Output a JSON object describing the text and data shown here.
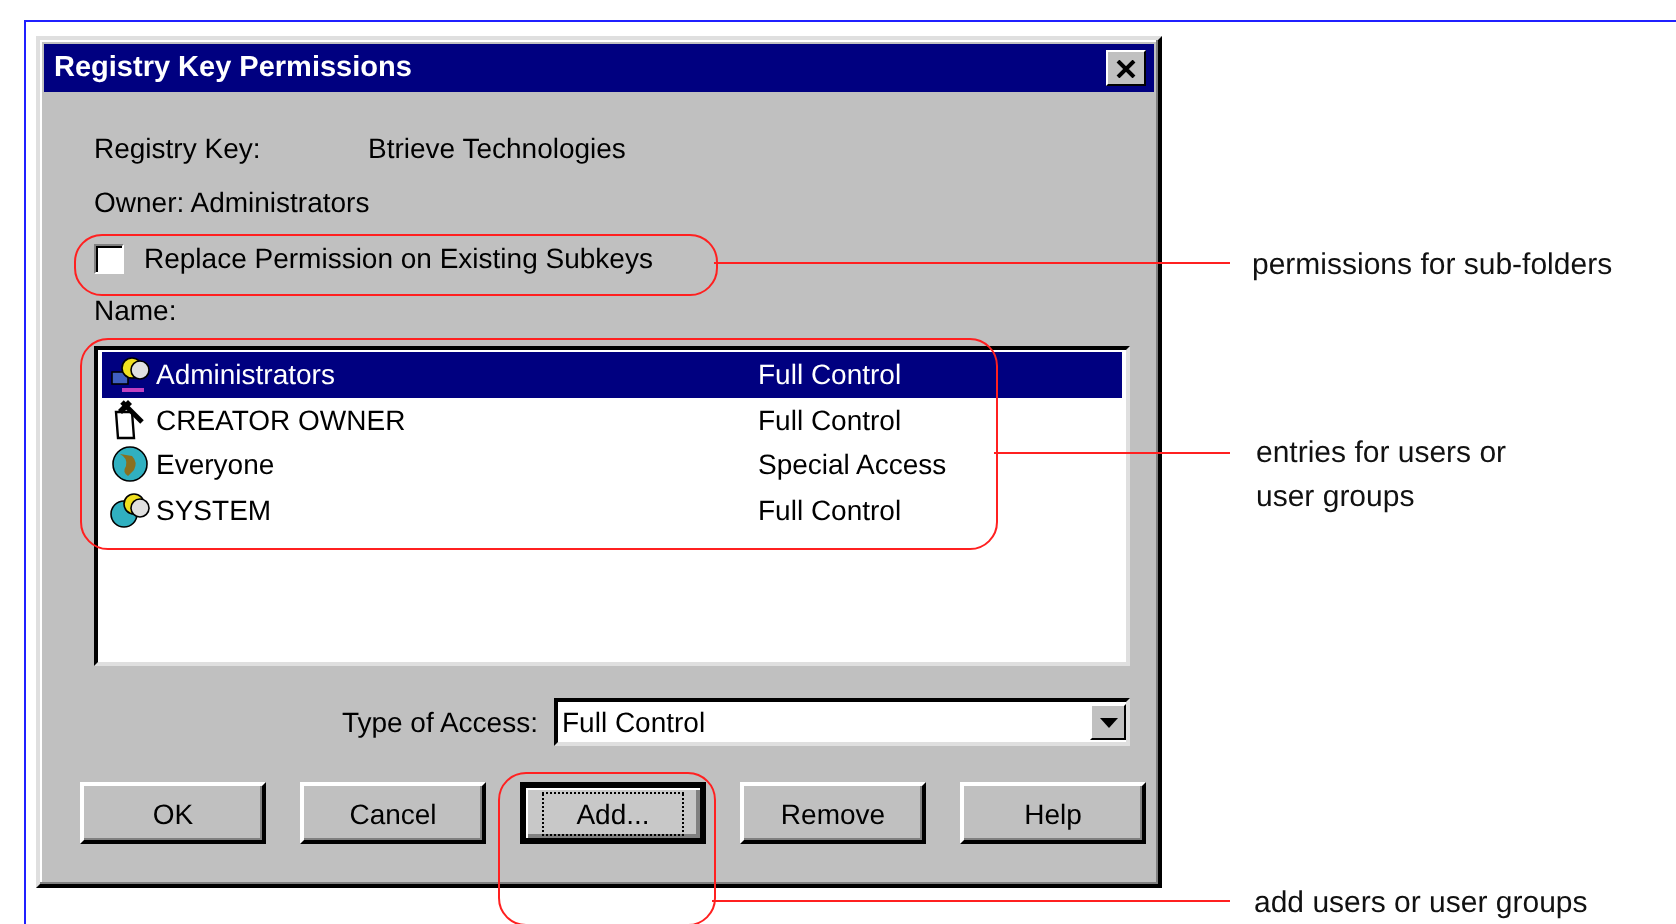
{
  "window": {
    "title": "Registry Key Permissions"
  },
  "registry_key": {
    "label": "Registry Key:",
    "value": "Btrieve Technologies"
  },
  "owner": "Owner:  Administrators",
  "replace_checkbox": {
    "label": "Replace Permission on Existing Subkeys",
    "checked": false
  },
  "name_label": "Name:",
  "entries": [
    {
      "kind": "group",
      "name": "Administrators",
      "access": "Full Control",
      "selected": true
    },
    {
      "kind": "creator",
      "name": "CREATOR OWNER",
      "access": "Full Control",
      "selected": false
    },
    {
      "kind": "everyone",
      "name": "Everyone",
      "access": "Special Access",
      "selected": false
    },
    {
      "kind": "system",
      "name": "SYSTEM",
      "access": "Full Control",
      "selected": false
    }
  ],
  "type_of_access": {
    "label": "Type of Access:",
    "value": "Full Control"
  },
  "buttons": [
    {
      "label": "OK",
      "focused": false
    },
    {
      "label": "Cancel",
      "focused": false
    },
    {
      "label": "Add...",
      "focused": true
    },
    {
      "label": "Remove",
      "focused": false
    },
    {
      "label": "Help",
      "focused": false
    }
  ],
  "callouts": [
    {
      "text": "permissions for sub-folders"
    },
    {
      "text": "entries for users or user groups"
    },
    {
      "text": "add users or user groups"
    }
  ]
}
